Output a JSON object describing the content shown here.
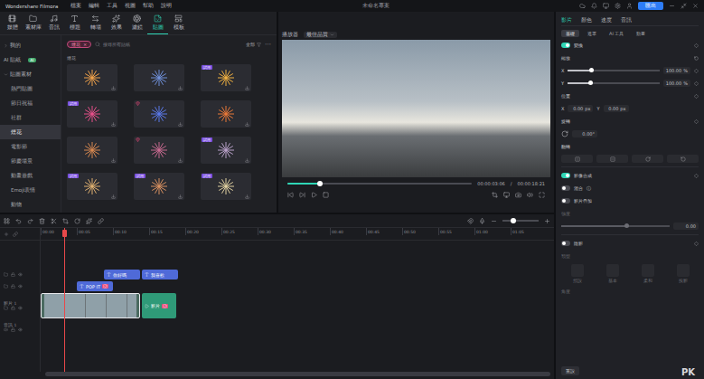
{
  "titlebar": {
    "app": "Wondershare Filmora",
    "menus": [
      "檔案",
      "編輯",
      "工具",
      "視圖",
      "幫助",
      "說明"
    ],
    "project": "未命名專案",
    "export": "匯出"
  },
  "toolbar": [
    {
      "label": "媒體",
      "selected": false
    },
    {
      "label": "素材庫",
      "selected": false
    },
    {
      "label": "音訊",
      "selected": false
    },
    {
      "label": "標題",
      "selected": false
    },
    {
      "label": "轉場",
      "selected": false
    },
    {
      "label": "效果",
      "selected": false
    },
    {
      "label": "濾鏡",
      "selected": false
    },
    {
      "label": "貼圖",
      "selected": true
    },
    {
      "label": "模板",
      "selected": false
    }
  ],
  "sidebar": [
    {
      "label": "我的",
      "kind": "group",
      "expanded": false,
      "selected": false
    },
    {
      "label": "AI 貼紙",
      "kind": "ai",
      "badge": "AI",
      "selected": false
    },
    {
      "label": "貼圖素材",
      "kind": "group",
      "expanded": true,
      "selected": false
    },
    {
      "label": "熱門貼圖",
      "kind": "item",
      "selected": false
    },
    {
      "label": "節日祝福",
      "kind": "item",
      "selected": false
    },
    {
      "label": "社群",
      "kind": "item",
      "selected": false
    },
    {
      "label": "煙花",
      "kind": "item",
      "selected": true
    },
    {
      "label": "電影節",
      "kind": "item",
      "selected": false
    },
    {
      "label": "節慶場景",
      "kind": "item",
      "selected": false
    },
    {
      "label": "動畫遊戲",
      "kind": "item",
      "selected": false
    },
    {
      "label": "Emoji表情",
      "kind": "item",
      "selected": false
    },
    {
      "label": "動物",
      "kind": "item",
      "selected": false
    }
  ],
  "library": {
    "tag": "煙花",
    "tag_close": "×",
    "search_placeholder": "搜尋所有貼紙",
    "filter": "全部",
    "more": "⋯",
    "section": "煙花",
    "items": [
      {
        "kind": "free",
        "color": "#f2a24a"
      },
      {
        "kind": "free",
        "color": "#6f8fd8"
      },
      {
        "kind": "trial",
        "badge": "試用",
        "color": "#f0b040"
      },
      {
        "kind": "trial",
        "badge": "試用",
        "color": "#e8508a"
      },
      {
        "kind": "premium",
        "color": "#5a78e8"
      },
      {
        "kind": "free",
        "color": "#e87838"
      },
      {
        "kind": "free",
        "color": "#d88850"
      },
      {
        "kind": "premium",
        "color": "#c86a90"
      },
      {
        "kind": "trial",
        "badge": "試用",
        "color": "#b8a0c8"
      },
      {
        "kind": "trial",
        "badge": "試用",
        "color": "#e0b070"
      },
      {
        "kind": "trial",
        "badge": "試用",
        "color": "#d89060"
      },
      {
        "kind": "trial",
        "badge": "試用",
        "color": "#e0d0a0"
      }
    ]
  },
  "preview": {
    "label": "播放器",
    "quality": "最佳品質",
    "level": 0.175,
    "time_current": "00:00:03:06",
    "time_separator": "/",
    "time_total": "00:00:18:21"
  },
  "inspector": {
    "tabs": [
      {
        "label": "影片",
        "selected": true
      },
      {
        "label": "顏色",
        "selected": false
      },
      {
        "label": "速度",
        "selected": false
      },
      {
        "label": "音訊",
        "selected": false
      }
    ],
    "subtabs": [
      {
        "label": "基礎",
        "selected": true
      },
      {
        "label": "遮罩",
        "selected": false
      },
      {
        "label": "AI 工具",
        "selected": false
      },
      {
        "label": "動畫",
        "selected": false
      }
    ],
    "transform": {
      "label": "變換",
      "on": true
    },
    "scale": {
      "label": "縮放",
      "axes": [
        {
          "axis": "X",
          "value": "100.00",
          "unit": "%",
          "level": 0.25
        },
        {
          "axis": "Y",
          "value": "100.00",
          "unit": "%",
          "level": 0.25
        }
      ]
    },
    "position": {
      "label": "位置",
      "axes": [
        {
          "axis": "X",
          "value": "0.00",
          "unit": "px"
        },
        {
          "axis": "Y",
          "value": "0.00",
          "unit": "px"
        }
      ]
    },
    "rotate": {
      "label": "旋轉",
      "value": "0.00°"
    },
    "flip": {
      "label": "翻轉"
    },
    "compositing": {
      "label": "影像合成",
      "on": true
    },
    "toggles": [
      {
        "label": "混合",
        "info": "ⓘ",
        "on": false
      },
      {
        "label": "影片疊加",
        "info": "",
        "on": false
      }
    ],
    "strength": {
      "label": "強度",
      "value": "0.00",
      "level": 0.6,
      "disabled": true
    },
    "shadow": {
      "label": "陰影",
      "on": false
    },
    "shadow_type": {
      "label": "類型",
      "options": [
        "預設",
        "基本",
        "柔和",
        "投影"
      ]
    },
    "angle": {
      "label": "角度"
    },
    "reset": "重設",
    "watermark": "PK"
  },
  "timeline": {
    "zoom": {
      "level": 0.3
    },
    "ruler": [
      "00:00",
      "00:05",
      "00:10",
      "00:15",
      "00:20",
      "00:25",
      "00:30",
      "00:35",
      "00:40",
      "00:45",
      "00:50",
      "00:55",
      "01:00",
      "01:05"
    ],
    "tracks": [
      {
        "kind": "title",
        "label": "",
        "clips": [
          {
            "text": "你好嗎",
            "kind": "title",
            "sticker": false
          },
          {
            "text": "我喜歡",
            "kind": "title",
            "sticker": false
          }
        ]
      },
      {
        "kind": "title",
        "label": "",
        "clips": [
          {
            "text": "POP IT",
            "kind": "title",
            "sticker": true
          }
        ]
      },
      {
        "kind": "video",
        "label": "影片 1",
        "clips": [
          {
            "text": "",
            "kind": "footage",
            "sticker": false
          },
          {
            "text": "影片",
            "kind": "green",
            "sticker": true
          }
        ]
      },
      {
        "kind": "audio",
        "label": "音訊 1",
        "clips": []
      }
    ]
  }
}
